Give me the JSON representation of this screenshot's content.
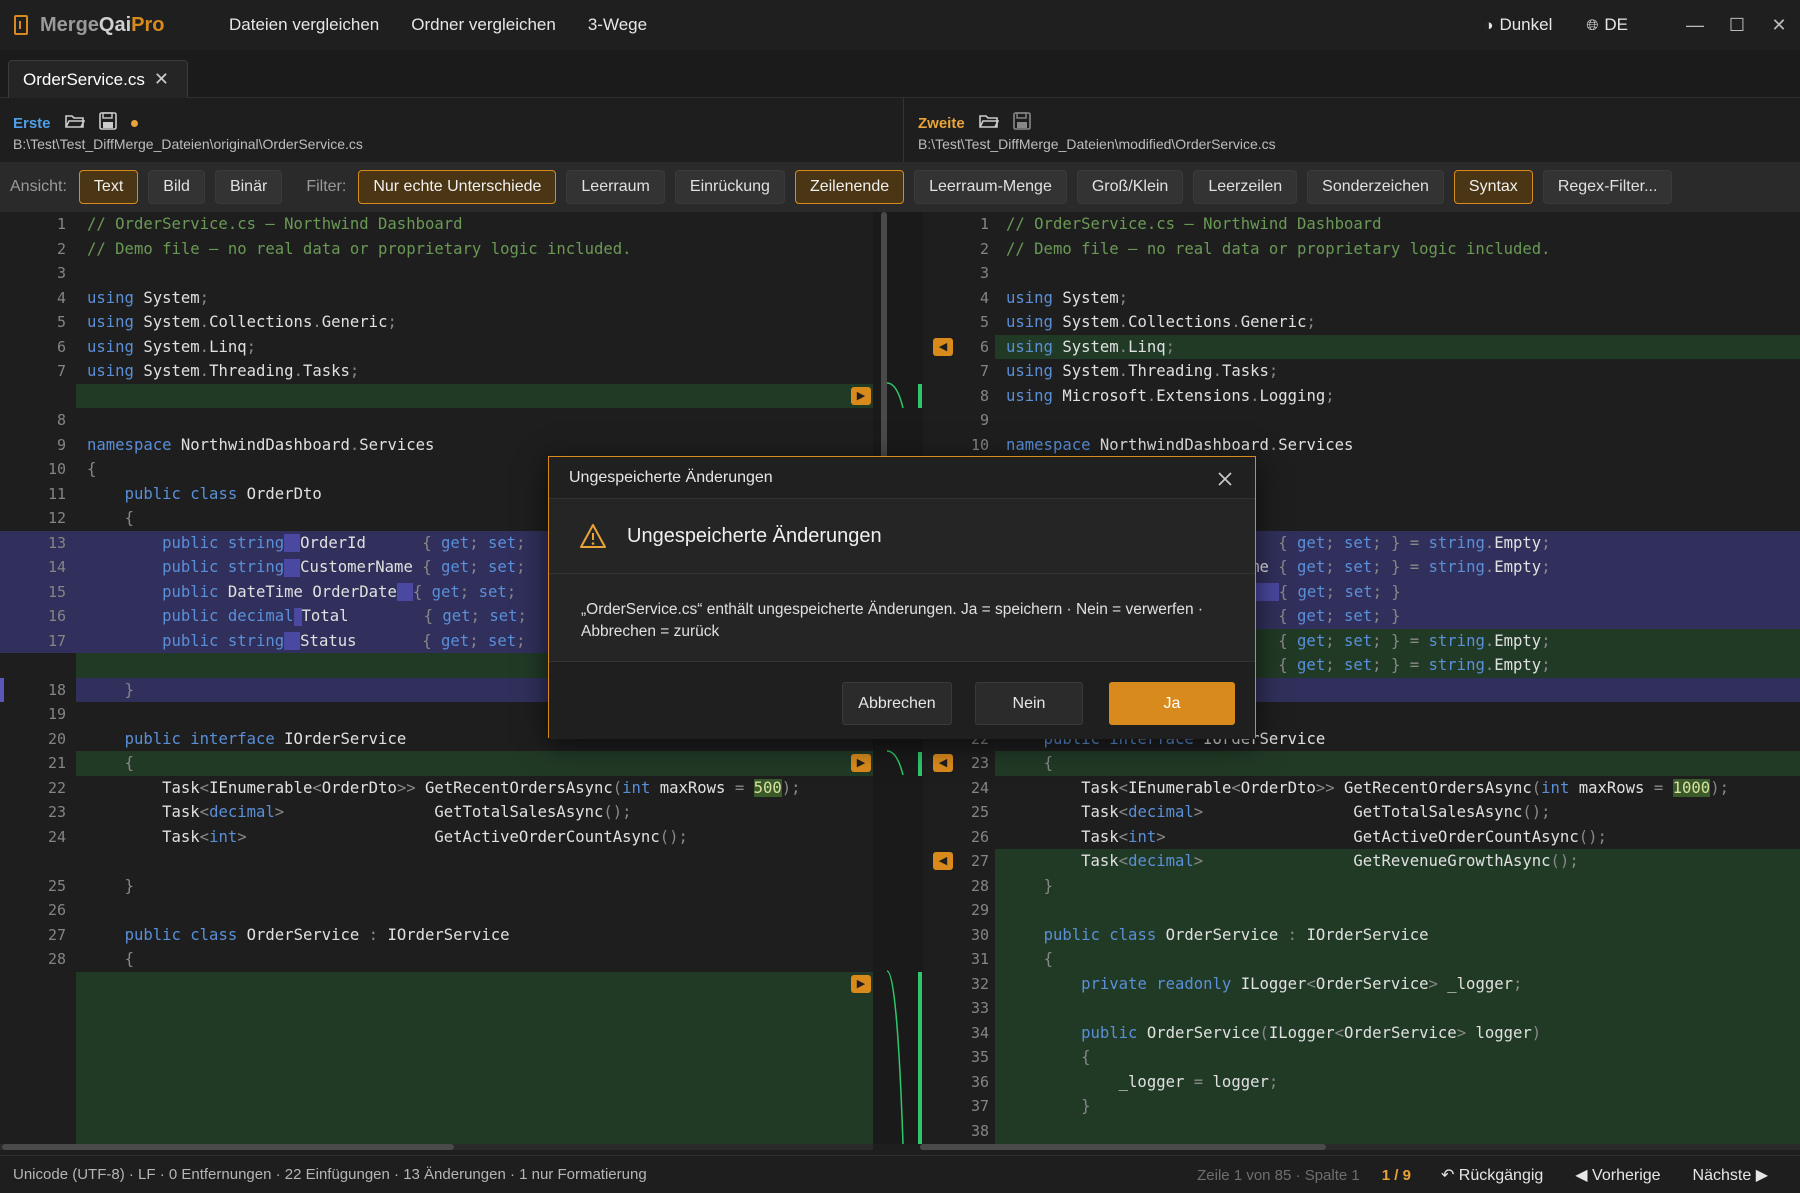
{
  "app": {
    "logo": [
      "Merge",
      "Qai",
      "Pro"
    ],
    "menu": [
      "Dateien vergleichen",
      "Ordner vergleichen",
      "3-Wege"
    ],
    "theme_label": "Dunkel",
    "language_label": "DE",
    "window_buttons": [
      "—",
      "☐",
      "✕"
    ]
  },
  "tab": {
    "label": "OrderService.cs",
    "close": "✕"
  },
  "left_file": {
    "label": "Erste",
    "path": "B:\\Test\\Test_DiffMerge_Dateien\\original\\OrderService.cs",
    "label_color": "#4f9ee8"
  },
  "right_file": {
    "label": "Zweite",
    "path": "B:\\Test\\Test_DiffMerge_Dateien\\modified\\OrderService.cs",
    "label_color": "#e8a33a"
  },
  "viewbar": {
    "view_label": "Ansicht:",
    "views": [
      {
        "label": "Text",
        "on": true
      },
      {
        "label": "Bild",
        "on": false
      },
      {
        "label": "Binär",
        "on": false
      }
    ],
    "filter_label": "Filter:",
    "filters": [
      {
        "label": "Nur echte Unterschiede",
        "on": true
      },
      {
        "label": "Leerraum",
        "on": false
      },
      {
        "label": "Einrückung",
        "on": false
      },
      {
        "label": "Zeilenende",
        "on": true
      },
      {
        "label": "Leerraum-Menge",
        "on": false
      },
      {
        "label": "Groß/Klein",
        "on": false
      },
      {
        "label": "Leerzeilen",
        "on": false
      },
      {
        "label": "Sonderzeichen",
        "on": false
      },
      {
        "label": "Syntax",
        "on": true
      },
      {
        "label": "Regex-Filter...",
        "on": false
      }
    ]
  },
  "left_lines": [
    {
      "n": "1",
      "html": "<span class='c'>// OrderService.cs — Northwind Dashboard</span>"
    },
    {
      "n": "2",
      "html": "<span class='c'>// Demo file — no real data or proprietary logic included.</span>"
    },
    {
      "n": "3",
      "html": ""
    },
    {
      "n": "4",
      "html": "<span class='k'>using</span> System<span class='p'>;</span>"
    },
    {
      "n": "5",
      "html": "<span class='k'>using</span> System<span class='p'>.</span>Collections<span class='p'>.</span>Generic<span class='p'>;</span>"
    },
    {
      "n": "6",
      "html": "<span class='k'>using</span> System<span class='p'>.</span>Linq<span class='p'>;</span>"
    },
    {
      "n": "7",
      "html": "<span class='k'>using</span> System<span class='p'>.</span>Threading<span class='p'>.</span>Tasks<span class='p'>;</span>"
    },
    {
      "n": "",
      "html": ""
    },
    {
      "n": "8",
      "html": ""
    },
    {
      "n": "9",
      "html": "<span class='k'>namespace</span> NorthwindDashboard<span class='p'>.</span>Services"
    },
    {
      "n": "10",
      "html": "<span class='p'>{</span>"
    },
    {
      "n": "11",
      "html": "    <span class='k'>public class</span> OrderDto"
    },
    {
      "n": "12",
      "html": "    <span class='p'>{</span>"
    },
    {
      "n": "13",
      "html": "        <span class='k'>public string</span><span class='inl'></span>OrderId      <span class='p'>{</span> <span class='k'>get</span><span class='p'>;</span> <span class='k'>set</span><span class='p'>;</span>"
    },
    {
      "n": "14",
      "html": "        <span class='k'>public string</span><span class='inl'></span>CustomerName <span class='p'>{</span> <span class='k'>get</span><span class='p'>;</span> <span class='k'>set</span><span class='p'>;</span>"
    },
    {
      "n": "15",
      "html": "        <span class='k'>public</span> DateTime OrderDate<span class='inl'></span><span class='p'>{</span> <span class='k'>get</span><span class='p'>;</span> <span class='k'>set</span><span class='p'>;</span>"
    },
    {
      "n": "16",
      "html": "        <span class='k'>public decimal</span><span class='inl' style='width:8px'></span>Total        <span class='p'>{</span> <span class='k'>get</span><span class='p'>;</span> <span class='k'>set</span><span class='p'>;</span>"
    },
    {
      "n": "17",
      "html": "        <span class='k'>public string</span><span class='inl'></span>Status       <span class='p'>{</span> <span class='k'>get</span><span class='p'>;</span> <span class='k'>set</span><span class='p'>;</span>"
    },
    {
      "n": "",
      "html": ""
    },
    {
      "n": "18",
      "html": "    <span class='p'>}</span>"
    },
    {
      "n": "19",
      "html": ""
    },
    {
      "n": "20",
      "html": "    <span class='k'>public interface</span> IOrderService"
    },
    {
      "n": "21",
      "html": "    <span class='p'>{</span>"
    },
    {
      "n": "22",
      "html": "        Task<span class='p'>&lt;</span>IEnumerable<span class='p'>&lt;</span>OrderDto<span class='p'>&gt;&gt;</span> GetRecentOrdersAsync<span class='p'>(</span><span class='k'>int</span> maxRows <span class='p'>=</span> <span class='num'>500</span><span class='p'>);</span>"
    },
    {
      "n": "23",
      "html": "        Task<span class='p'>&lt;</span><span class='k'>decimal</span><span class='p'>&gt;</span>                GetTotalSalesAsync<span class='p'>();</span>"
    },
    {
      "n": "24",
      "html": "        Task<span class='p'>&lt;</span><span class='k'>int</span><span class='p'>&gt;</span>                    GetActiveOrderCountAsync<span class='p'>();</span>"
    },
    {
      "n": "",
      "html": ""
    },
    {
      "n": "25",
      "html": "    <span class='p'>}</span>"
    },
    {
      "n": "26",
      "html": ""
    },
    {
      "n": "27",
      "html": "    <span class='k'>public class</span> OrderService <span class='p'>:</span> IOrderService"
    },
    {
      "n": "28",
      "html": "    <span class='p'>{</span>"
    }
  ],
  "right_lines": [
    {
      "n": "1",
      "html": "<span class='c'>// OrderService.cs — Northwind Dashboard</span>"
    },
    {
      "n": "2",
      "html": "<span class='c'>// Demo file — no real data or proprietary logic included.</span>"
    },
    {
      "n": "3",
      "html": ""
    },
    {
      "n": "4",
      "html": "<span class='k'>using</span> System<span class='p'>;</span>"
    },
    {
      "n": "5",
      "html": "<span class='k'>using</span> System<span class='p'>.</span>Collections<span class='p'>.</span>Generic<span class='p'>;</span>"
    },
    {
      "n": "6",
      "html": "<span class='k'>using</span> System<span class='p'>.</span>Linq<span class='p'>;</span>"
    },
    {
      "n": "7",
      "html": "<span class='k'>using</span> System<span class='p'>.</span>Threading<span class='p'>.</span>Tasks<span class='p'>;</span>"
    },
    {
      "n": "8",
      "html": "<span class='k'>using</span> Microsoft<span class='p'>.</span>Extensions<span class='p'>.</span>Logging<span class='p'>;</span>"
    },
    {
      "n": "9",
      "html": ""
    },
    {
      "n": "10",
      "html": "<span class='k'>namespace</span> NorthwindDashboard<span class='p'>.</span>Services"
    },
    {
      "n": "",
      "html": ""
    },
    {
      "n": "",
      "html": ""
    },
    {
      "n": "",
      "html": ""
    },
    {
      "n": "",
      "html": "                  derId      <span class='p'>{</span> <span class='k'>get</span><span class='p'>;</span> <span class='k'>set</span><span class='p'>;</span> <span class='p'>}</span> <span class='p'>=</span> <span class='k'>string</span><span class='p'>.</span>Empty<span class='p'>;</span>"
    },
    {
      "n": "",
      "html": "                  stomerName <span class='p'>{</span> <span class='k'>get</span><span class='p'>;</span> <span class='k'>set</span><span class='p'>;</span> <span class='p'>}</span> <span class='p'>=</span> <span class='k'>string</span><span class='p'>.</span>Empty<span class='p'>;</span>"
    },
    {
      "n": "",
      "html": "                  derDate<span class='inl' style='width:38px'></span><span class='p'>{</span> <span class='k'>get</span><span class='p'>;</span> <span class='k'>set</span><span class='p'>;</span> <span class='p'>}</span>"
    },
    {
      "n": "",
      "html": "                  tal        <span class='p'>{</span> <span class='k'>get</span><span class='p'>;</span> <span class='k'>set</span><span class='p'>;</span> <span class='p'>}</span>"
    },
    {
      "n": "",
      "html": "                  atus       <span class='p'>{</span> <span class='k'>get</span><span class='p'>;</span> <span class='k'>set</span><span class='p'>;</span> <span class='p'>}</span> <span class='p'>=</span> <span class='k'>string</span><span class='p'>.</span>Empty<span class='p'>;</span>"
    },
    {
      "n": "",
      "html": "                  gion       <span class='p'>{</span> <span class='k'>get</span><span class='p'>;</span> <span class='k'>set</span><span class='p'>;</span> <span class='p'>}</span> <span class='p'>=</span> <span class='k'>string</span><span class='p'>.</span>Empty<span class='p'>;</span>"
    },
    {
      "n": "",
      "html": ""
    },
    {
      "n": "",
      "html": ""
    },
    {
      "n": "22",
      "html": "    <span class='k'>public interface</span> IOrderService"
    },
    {
      "n": "23",
      "html": "    <span class='p'>{</span>"
    },
    {
      "n": "24",
      "html": "        Task<span class='p'>&lt;</span>IEnumerable<span class='p'>&lt;</span>OrderDto<span class='p'>&gt;&gt;</span> GetRecentOrdersAsync<span class='p'>(</span><span class='k'>int</span> maxRows <span class='p'>=</span> <span class='num'>1000</span><span class='p'>);</span>"
    },
    {
      "n": "25",
      "html": "        Task<span class='p'>&lt;</span><span class='k'>decimal</span><span class='p'>&gt;</span>                GetTotalSalesAsync<span class='p'>();</span>"
    },
    {
      "n": "26",
      "html": "        Task<span class='p'>&lt;</span><span class='k'>int</span><span class='p'>&gt;</span>                    GetActiveOrderCountAsync<span class='p'>();</span>"
    },
    {
      "n": "27",
      "html": "        Task<span class='p'>&lt;</span><span class='k'>decimal</span><span class='p'>&gt;</span>                GetRevenueGrowthAsync<span class='p'>();</span>"
    },
    {
      "n": "28",
      "html": "    <span class='p'>}</span>"
    },
    {
      "n": "29",
      "html": ""
    },
    {
      "n": "30",
      "html": "    <span class='k'>public class</span> OrderService <span class='p'>:</span> IOrderService"
    },
    {
      "n": "31",
      "html": "    <span class='p'>{</span>"
    },
    {
      "n": "32",
      "html": "        <span class='k'>private readonly</span> ILogger<span class='p'>&lt;</span>OrderService<span class='p'>&gt;</span> _logger<span class='p'>;</span>"
    },
    {
      "n": "33",
      "html": ""
    },
    {
      "n": "34",
      "html": "        <span class='k'>public</span> OrderService<span class='p'>(</span>ILogger<span class='p'>&lt;</span>OrderService<span class='p'>&gt;</span> logger<span class='p'>)</span>"
    },
    {
      "n": "35",
      "html": "        <span class='p'>{</span>"
    },
    {
      "n": "36",
      "html": "            _logger <span class='p'>=</span> logger<span class='p'>;</span>"
    },
    {
      "n": "37",
      "html": "        <span class='p'>}</span>"
    },
    {
      "n": "38",
      "html": ""
    }
  ],
  "dialog": {
    "title": "Ungespeicherte Änderungen",
    "heading": "Ungespeicherte Änderungen",
    "message": "„OrderService.cs“ enthält ungespeicherte Änderungen. Ja = speichern · Nein = verwerfen · Abbrechen = zurück",
    "cancel": "Abbrechen",
    "no": "Nein",
    "yes": "Ja"
  },
  "status": {
    "summary": "Unicode (UTF-8)  ·  LF  ·  0 Entfernungen  ·  22 Einfügungen  ·  13 Änderungen  ·  1 nur Formatierung",
    "position": "Zeile 1 von 85 · Spalte 1",
    "diff_counter": "1 / 9",
    "undo": "↶ Rückgängig",
    "prev": "◀ Vorherige",
    "next": "Nächste ▶"
  },
  "colors": {
    "accent": "#d98a1c",
    "added": "#213a26",
    "modified": "#31305c",
    "gutter_added": "#2ec86a"
  }
}
